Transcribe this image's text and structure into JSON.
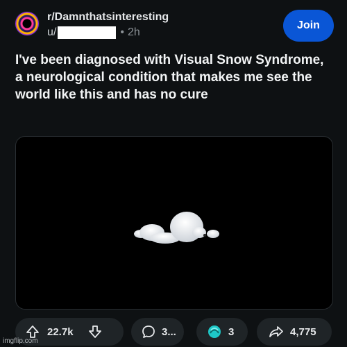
{
  "header": {
    "subreddit": "r/Damnthatsinteresting",
    "author_prefix": "u/",
    "dot": "•",
    "time": "2h",
    "join_label": "Join"
  },
  "post": {
    "title": "I've been diagnosed with Visual Snow Syndrome, a neurological condition that makes me see the world like this and has no cure"
  },
  "actions": {
    "upvotes": "22.7k",
    "comments": "3...",
    "awards": "3",
    "shares": "4,775"
  },
  "watermark": "imgflip.com",
  "colors": {
    "background": "#0e1113",
    "join_button": "#0a56d6",
    "pill": "#1f2427"
  }
}
